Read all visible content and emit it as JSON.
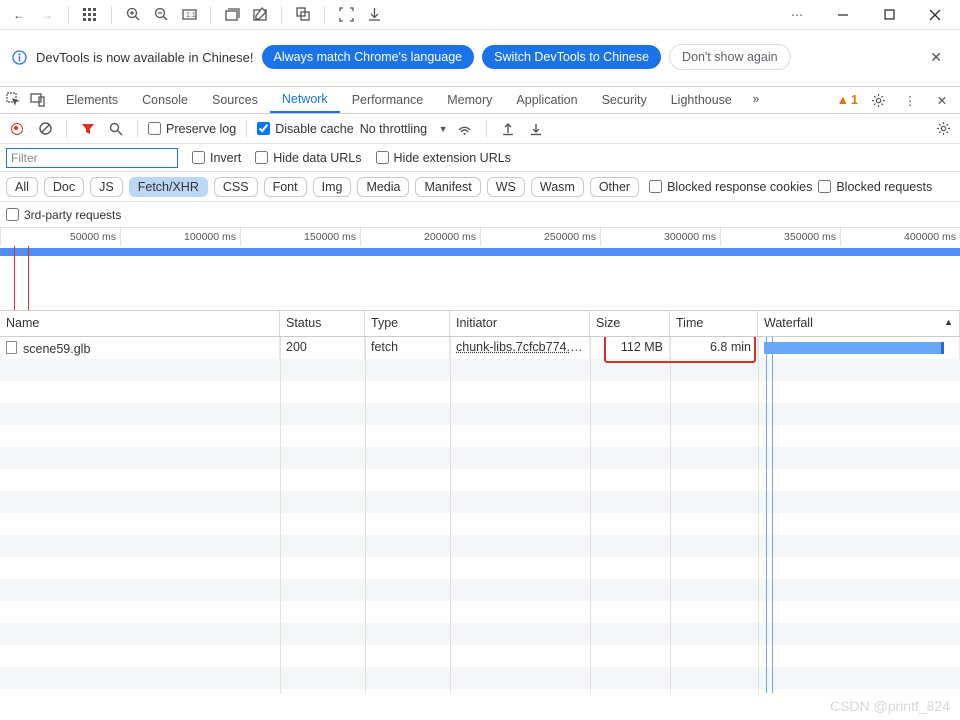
{
  "info_bar": {
    "message": "DevTools is now available in Chinese!",
    "btn_always": "Always match Chrome's language",
    "btn_switch": "Switch DevTools to Chinese",
    "btn_dont": "Don't show again"
  },
  "tabs": {
    "elements": "Elements",
    "console": "Console",
    "sources": "Sources",
    "network": "Network",
    "performance": "Performance",
    "memory": "Memory",
    "application": "Application",
    "security": "Security",
    "lighthouse": "Lighthouse"
  },
  "warn_count": "1",
  "net_toolbar": {
    "preserve_log": "Preserve log",
    "disable_cache": "Disable cache",
    "throttling": "No throttling"
  },
  "filter": {
    "placeholder": "Filter",
    "invert": "Invert",
    "hide_data": "Hide data URLs",
    "hide_ext": "Hide extension URLs"
  },
  "chips": {
    "all": "All",
    "doc": "Doc",
    "js": "JS",
    "fetch": "Fetch/XHR",
    "css": "CSS",
    "font": "Font",
    "img": "Img",
    "media": "Media",
    "manifest": "Manifest",
    "ws": "WS",
    "wasm": "Wasm",
    "other": "Other",
    "blocked_cookies": "Blocked response cookies",
    "blocked_requests": "Blocked requests",
    "third_party": "3rd-party requests"
  },
  "ruler": [
    "50000 ms",
    "100000 ms",
    "150000 ms",
    "200000 ms",
    "250000 ms",
    "300000 ms",
    "350000 ms",
    "400000 ms"
  ],
  "columns": {
    "name": "Name",
    "status": "Status",
    "type": "Type",
    "initiator": "Initiator",
    "size": "Size",
    "time": "Time",
    "waterfall": "Waterfall"
  },
  "rows": [
    {
      "name": "scene59.glb",
      "status": "200",
      "type": "fetch",
      "initiator": "chunk-libs.7cfcb774.j…",
      "size": "112 MB",
      "time": "6.8 min"
    }
  ],
  "watermark": "CSDN @printf_824"
}
